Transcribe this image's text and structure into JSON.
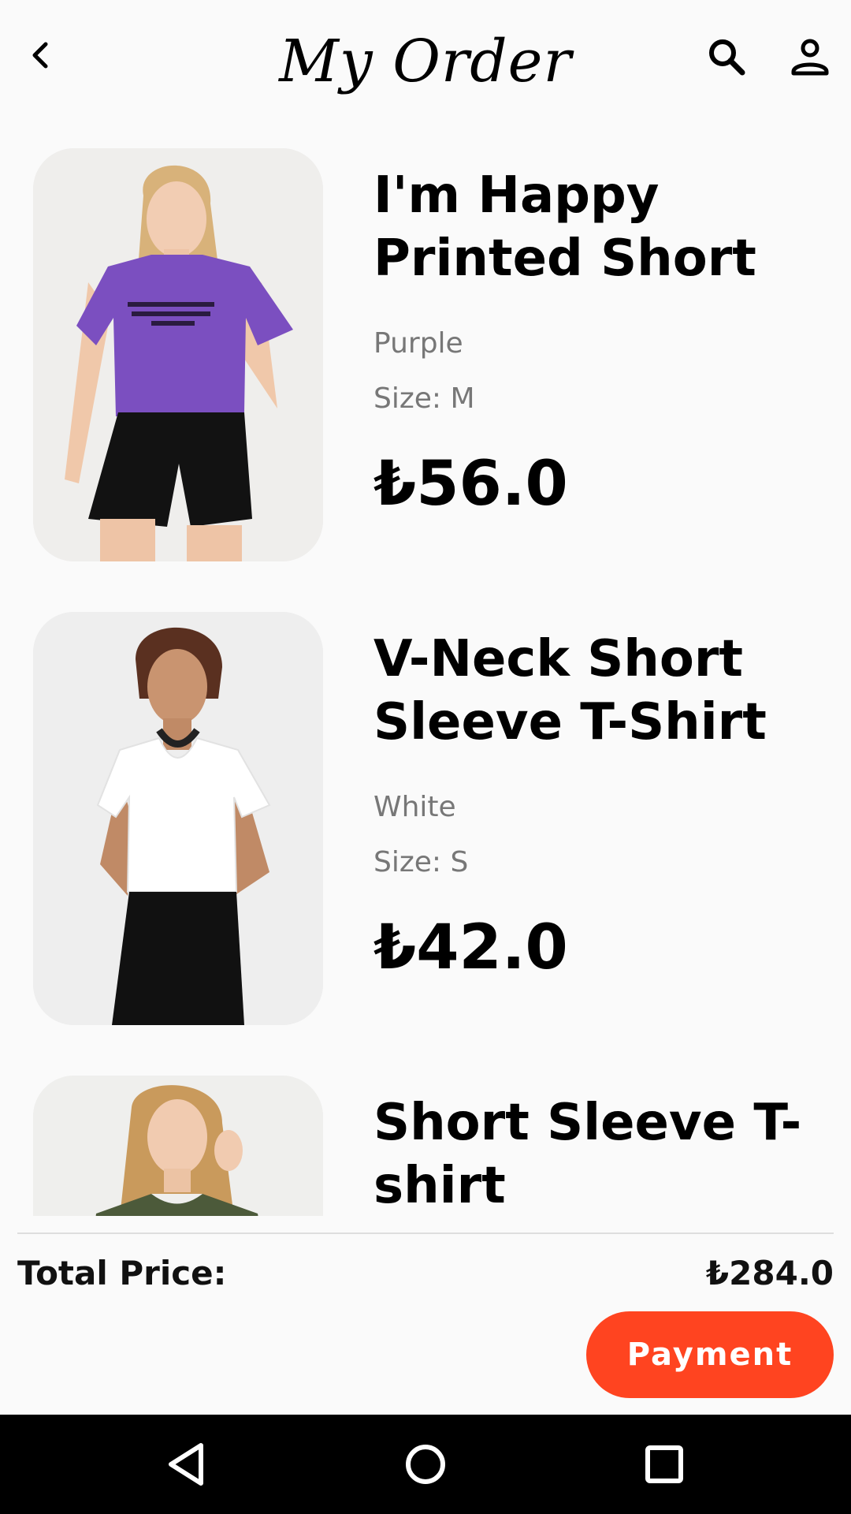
{
  "header": {
    "title": "My Order",
    "back_icon": "chevron-left-icon",
    "search_icon": "search-icon",
    "account_icon": "person-icon"
  },
  "orders": [
    {
      "name": "I'm Happy Printed Short",
      "color": "Purple",
      "size": "Size: M",
      "price": "₺56.0",
      "shirt_color": "#7b4fc0"
    },
    {
      "name": "V-Neck Short Sleeve T-Shirt",
      "color": "White",
      "size": "Size: S",
      "price": "₺42.0",
      "shirt_color": "#ffffff"
    },
    {
      "name": "Short Sleeve T-shirt",
      "color": "",
      "size": "",
      "price": "",
      "shirt_color": "#4c5a3a"
    }
  ],
  "summary": {
    "total_label": "Total Price:",
    "total_value": "₺284.0",
    "payment_label": "Payment"
  },
  "colors": {
    "accent": "#ff4420",
    "background": "#fafafa",
    "muted_text": "#777777"
  },
  "system_nav": {
    "back_icon": "triangle-back-icon",
    "home_icon": "circle-home-icon",
    "recents_icon": "square-recents-icon"
  }
}
